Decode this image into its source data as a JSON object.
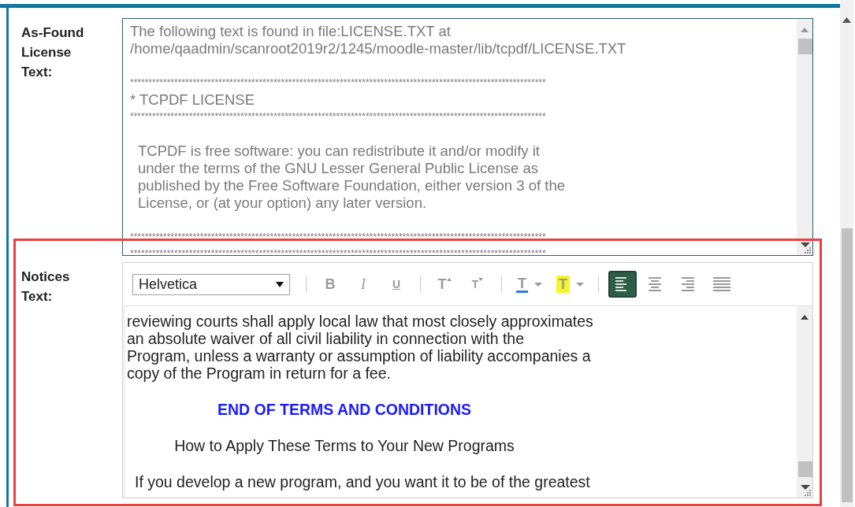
{
  "fields": [
    {
      "label": "As-Found License Text:",
      "kind": "plain",
      "paragraphs": [
        {
          "kind": "body",
          "lines": [
            {
              "kind": "text",
              "text": "The following text is found in file:LICENSE.TXT at"
            },
            {
              "kind": "text",
              "text": "/home/qaadmin/scanroot2019r2/1245/moodle-master/lib/tcpdf/LICENSE.TXT"
            }
          ]
        },
        {
          "kind": "body",
          "lines": [
            {
              "kind": "stars",
              "text": "*****************************************************************************************************************"
            },
            {
              "kind": "text",
              "text": "* TCPDF LICENSE"
            },
            {
              "kind": "stars",
              "text": "*****************************************************************************************************************"
            }
          ]
        },
        {
          "kind": "indented",
          "lines": [
            {
              "kind": "text",
              "text": "TCPDF is free software: you can redistribute it and/or modify it"
            },
            {
              "kind": "text",
              "text": "under the terms of the GNU Lesser General Public License as"
            },
            {
              "kind": "text",
              "text": "published by the Free Software Foundation, either version 3 of the"
            },
            {
              "kind": "text",
              "text": "License, or (at your option) any later version."
            }
          ]
        },
        {
          "kind": "body",
          "lines": [
            {
              "kind": "stars",
              "text": "*****************************************************************************************************************"
            },
            {
              "kind": "stars",
              "text": "*****************************************************************************************************************"
            }
          ]
        }
      ]
    },
    {
      "label": "Notices Text:",
      "kind": "editor",
      "highlighted": true,
      "toolbar": {
        "font": "Helvetica",
        "groups": [
          [
            {
              "kind": "bold",
              "label": "B",
              "selected": false
            },
            {
              "kind": "italic",
              "label": "I",
              "selected": false
            },
            {
              "kind": "underline",
              "label": "U",
              "selected": false
            }
          ],
          [
            {
              "kind": "grow",
              "label": "T",
              "selected": false
            },
            {
              "kind": "shrink",
              "label": "T",
              "selected": false
            }
          ],
          [
            {
              "kind": "color",
              "label": "T",
              "selected": false
            },
            {
              "kind": "highlight",
              "label": "T",
              "selected": false
            }
          ],
          [
            {
              "kind": "align-left",
              "selected": true
            },
            {
              "kind": "align-center",
              "selected": false
            },
            {
              "kind": "align-right",
              "selected": false
            },
            {
              "kind": "justify",
              "selected": false
            }
          ]
        ]
      },
      "paragraphs": [
        {
          "kind": "body",
          "lines": [
            {
              "kind": "text",
              "text": "reviewing courts shall apply local law that most closely approximates"
            },
            {
              "kind": "text",
              "text": "an absolute waiver of all civil liability in connection with the"
            },
            {
              "kind": "text",
              "text": "Program, unless a warranty or assumption of liability accompanies a"
            },
            {
              "kind": "text",
              "text": "copy of the Program in return for a fee."
            }
          ]
        },
        {
          "kind": "centered",
          "lines": [
            {
              "kind": "heading",
              "text": "END OF TERMS AND CONDITIONS"
            }
          ]
        },
        {
          "kind": "centered",
          "lines": [
            {
              "kind": "text",
              "text": "How to Apply These Terms to Your New Programs"
            }
          ]
        },
        {
          "kind": "indented",
          "lines": [
            {
              "kind": "text",
              "text": "If you develop a new program, and you want it to be of the greatest"
            }
          ]
        }
      ]
    }
  ]
}
